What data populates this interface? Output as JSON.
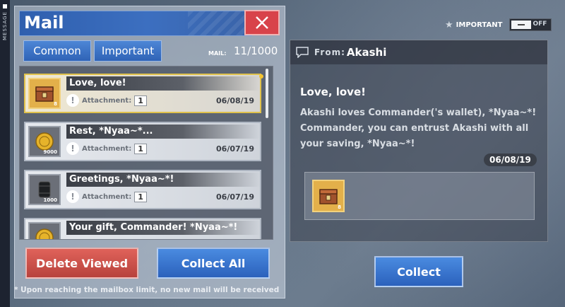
{
  "side": {
    "label": "MESSAGE"
  },
  "header": {
    "title": "Mail"
  },
  "tabs": [
    {
      "label": "Common"
    },
    {
      "label": "Important"
    }
  ],
  "mail_counter": {
    "label": "MAIL:",
    "value": "11/1000"
  },
  "mails": [
    {
      "subject": "Love, love!",
      "attachment_label": "Attachment:",
      "attachment_count": "1",
      "date": "06/08/19",
      "icon": "chest-icon",
      "qty": "8"
    },
    {
      "subject": "Rest, *Nyaa~*...",
      "attachment_label": "Attachment:",
      "attachment_count": "1",
      "date": "06/07/19",
      "icon": "coin-icon",
      "qty": "9000"
    },
    {
      "subject": "Greetings, *Nyaa~*!",
      "attachment_label": "Attachment:",
      "attachment_count": "1",
      "date": "06/07/19",
      "icon": "oil-barrel-icon",
      "qty": "1000"
    },
    {
      "subject": "Your gift, Commander! *Nyaa~*!",
      "icon": "coin-icon"
    }
  ],
  "buttons": {
    "delete_viewed": "Delete Viewed",
    "collect_all": "Collect All",
    "collect": "Collect"
  },
  "footnote": "* Upon reaching the mailbox limit, no new mail will be received",
  "important_toggle": {
    "label": "IMPORTANT",
    "state": "OFF"
  },
  "detail": {
    "from_label": "From:",
    "from_name": "Akashi",
    "subject": "Love, love!",
    "body": "Akashi loves Commander('s wallet), *Nyaa~*! Commander, you can entrust Akashi with all your saving, *Nyaa~*!",
    "date": "06/08/19",
    "attachment_qty": "8"
  },
  "colors": {
    "accent_blue": "#2f63b6",
    "danger_red": "#b8423c",
    "selected_gold": "#e0c24c"
  }
}
